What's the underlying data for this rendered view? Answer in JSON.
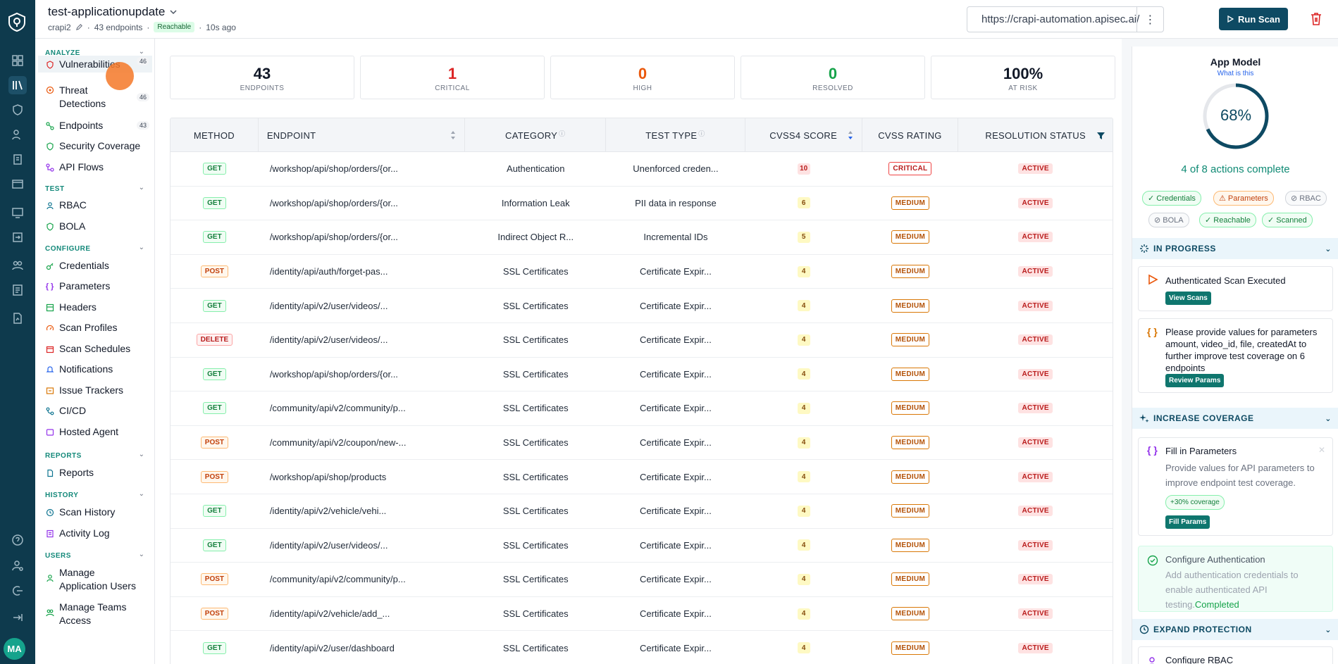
{
  "app": {
    "title": "test-applicationupdate",
    "owner": "crapi2",
    "endpoints_count": "43 endpoints",
    "reachable": "Reachable",
    "updated": "10s ago",
    "url": "https://crapi-automation.apisec.ai/",
    "run_scan": "Run Scan",
    "avatar": "MA"
  },
  "nav": {
    "analyze": "ANALYZE",
    "test": "TEST",
    "configure": "CONFIGURE",
    "reports": "REPORTS",
    "history": "HISTORY",
    "users": "USERS",
    "vulnerabilities": "Vulnerabilities",
    "vulnerabilities_count": "46",
    "threat_detections": "Threat Detections",
    "threat_detections_count": "46",
    "endpoints": "Endpoints",
    "endpoints_count": "43",
    "security_coverage": "Security Coverage",
    "api_flows": "API Flows",
    "rbac": "RBAC",
    "bola": "BOLA",
    "credentials": "Credentials",
    "parameters": "Parameters",
    "headers": "Headers",
    "scan_profiles": "Scan Profiles",
    "scan_schedules": "Scan Schedules",
    "notifications": "Notifications",
    "issue_trackers": "Issue Trackers",
    "cicd": "CI/CD",
    "hosted_agent": "Hosted Agent",
    "reports_item": "Reports",
    "scan_history": "Scan History",
    "activity_log": "Activity Log",
    "manage_app_users": "Manage Application Users",
    "manage_teams": "Manage Teams Access"
  },
  "stats": [
    {
      "value": "43",
      "label": "ENDPOINTS",
      "color": "#111827"
    },
    {
      "value": "1",
      "label": "CRITICAL",
      "color": "#dc2626"
    },
    {
      "value": "0",
      "label": "HIGH",
      "color": "#ea580c"
    },
    {
      "value": "0",
      "label": "RESOLVED",
      "color": "#16a34a"
    },
    {
      "value": "100%",
      "label": "AT RISK",
      "color": "#111827"
    }
  ],
  "table": {
    "headers": {
      "method": "METHOD",
      "endpoint": "ENDPOINT",
      "category": "CATEGORY",
      "test_type": "TEST TYPE",
      "score": "CVSS4 SCORE",
      "rating": "CVSS RATING",
      "status": "RESOLUTION STATUS"
    },
    "rows": [
      {
        "method": "GET",
        "endpoint": "/workshop/api/shop/orders/{or...",
        "category": "Authentication",
        "test_type": "Unenforced creden...",
        "score": "10",
        "rating": "CRITICAL",
        "status": "ACTIVE"
      },
      {
        "method": "GET",
        "endpoint": "/workshop/api/shop/orders/{or...",
        "category": "Information Leak",
        "test_type": "PII data in response",
        "score": "6",
        "rating": "MEDIUM",
        "status": "ACTIVE"
      },
      {
        "method": "GET",
        "endpoint": "/workshop/api/shop/orders/{or...",
        "category": "Indirect Object R...",
        "test_type": "Incremental IDs",
        "score": "5",
        "rating": "MEDIUM",
        "status": "ACTIVE"
      },
      {
        "method": "POST",
        "endpoint": "/identity/api/auth/forget-pas...",
        "category": "SSL Certificates",
        "test_type": "Certificate Expir...",
        "score": "4",
        "rating": "MEDIUM",
        "status": "ACTIVE"
      },
      {
        "method": "GET",
        "endpoint": "/identity/api/v2/user/videos/...",
        "category": "SSL Certificates",
        "test_type": "Certificate Expir...",
        "score": "4",
        "rating": "MEDIUM",
        "status": "ACTIVE"
      },
      {
        "method": "DELETE",
        "endpoint": "/identity/api/v2/user/videos/...",
        "category": "SSL Certificates",
        "test_type": "Certificate Expir...",
        "score": "4",
        "rating": "MEDIUM",
        "status": "ACTIVE"
      },
      {
        "method": "GET",
        "endpoint": "/workshop/api/shop/orders/{or...",
        "category": "SSL Certificates",
        "test_type": "Certificate Expir...",
        "score": "4",
        "rating": "MEDIUM",
        "status": "ACTIVE"
      },
      {
        "method": "GET",
        "endpoint": "/community/api/v2/community/p...",
        "category": "SSL Certificates",
        "test_type": "Certificate Expir...",
        "score": "4",
        "rating": "MEDIUM",
        "status": "ACTIVE"
      },
      {
        "method": "POST",
        "endpoint": "/community/api/v2/coupon/new-...",
        "category": "SSL Certificates",
        "test_type": "Certificate Expir...",
        "score": "4",
        "rating": "MEDIUM",
        "status": "ACTIVE"
      },
      {
        "method": "POST",
        "endpoint": "/workshop/api/shop/products",
        "category": "SSL Certificates",
        "test_type": "Certificate Expir...",
        "score": "4",
        "rating": "MEDIUM",
        "status": "ACTIVE"
      },
      {
        "method": "GET",
        "endpoint": "/identity/api/v2/vehicle/vehi...",
        "category": "SSL Certificates",
        "test_type": "Certificate Expir...",
        "score": "4",
        "rating": "MEDIUM",
        "status": "ACTIVE"
      },
      {
        "method": "GET",
        "endpoint": "/identity/api/v2/user/videos/...",
        "category": "SSL Certificates",
        "test_type": "Certificate Expir...",
        "score": "4",
        "rating": "MEDIUM",
        "status": "ACTIVE"
      },
      {
        "method": "POST",
        "endpoint": "/community/api/v2/community/p...",
        "category": "SSL Certificates",
        "test_type": "Certificate Expir...",
        "score": "4",
        "rating": "MEDIUM",
        "status": "ACTIVE"
      },
      {
        "method": "POST",
        "endpoint": "/identity/api/v2/vehicle/add_...",
        "category": "SSL Certificates",
        "test_type": "Certificate Expir...",
        "score": "4",
        "rating": "MEDIUM",
        "status": "ACTIVE"
      },
      {
        "method": "GET",
        "endpoint": "/identity/api/v2/user/dashboard",
        "category": "SSL Certificates",
        "test_type": "Certificate Expir...",
        "score": "4",
        "rating": "MEDIUM",
        "status": "ACTIVE"
      }
    ]
  },
  "app_model": {
    "title": "App Model",
    "link": "What is this",
    "percent": "68%",
    "progress": 0.68,
    "complete": "4 of 8 actions complete",
    "chips": {
      "credentials": "Credentials",
      "parameters": "Parameters",
      "rbac": "RBAC",
      "bola": "BOLA",
      "reachable": "Reachable",
      "scanned": "Scanned"
    },
    "in_progress": "IN PROGRESS",
    "increase_coverage": "INCREASE COVERAGE",
    "expand_protection": "EXPAND PROTECTION",
    "auth_scan": "Authenticated Scan Executed",
    "view_scans": "View Scans",
    "params_msg": "Please provide values for parameters amount, video_id, file, createdAt to further improve test coverage on 6 endpoints",
    "review_params": "Review Params",
    "fill_title": "Fill in Parameters",
    "fill_desc": "Provide values for API parameters to improve endpoint test coverage.",
    "coverage_badge": "+30% coverage",
    "fill_params": "Fill Params",
    "config_auth": "Configure Authentication",
    "config_auth_desc": "Add authentication credentials to enable authenticated API testing.",
    "completed": "Completed",
    "config_rbac": "Configure RBAC"
  }
}
